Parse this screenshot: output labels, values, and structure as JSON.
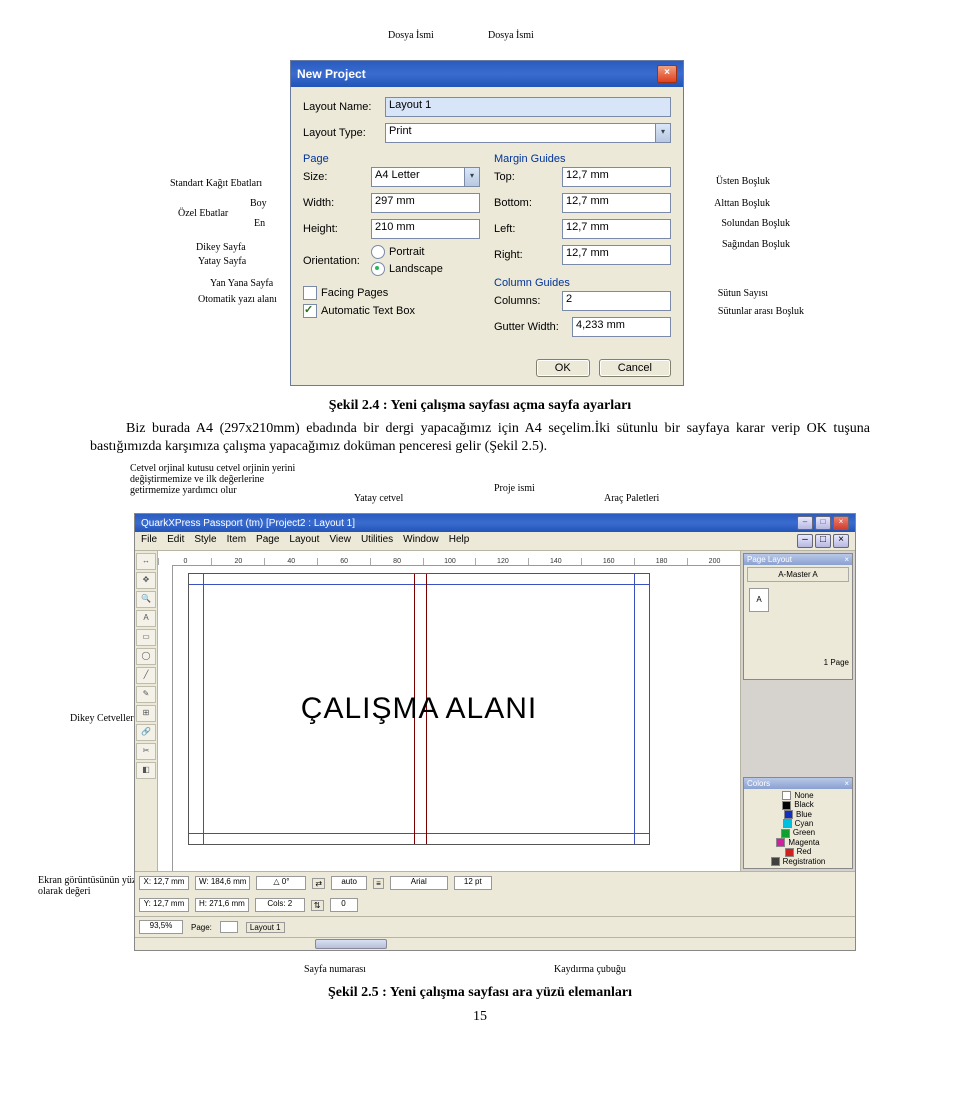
{
  "dialog": {
    "title": "New Project",
    "layout_name_label": "Layout Name:",
    "layout_name_value": "Layout 1",
    "layout_type_label": "Layout Type:",
    "layout_type_value": "Print",
    "page_head": "Page",
    "size_label": "Size:",
    "size_value": "A4 Letter",
    "width_label": "Width:",
    "width_value": "297 mm",
    "height_label": "Height:",
    "height_value": "210 mm",
    "orientation_label": "Orientation:",
    "portrait": "Portrait",
    "landscape": "Landscape",
    "facing": "Facing Pages",
    "autobox": "Automatic Text Box",
    "margin_head": "Margin Guides",
    "top_label": "Top:",
    "bottom_label": "Bottom:",
    "left_label": "Left:",
    "right_label": "Right:",
    "margin_val": "12,7 mm",
    "column_head": "Column Guides",
    "columns_label": "Columns:",
    "columns_value": "2",
    "gutter_label": "Gutter Width:",
    "gutter_value": "4,233 mm",
    "ok": "OK",
    "cancel": "Cancel"
  },
  "ann1": {
    "dosya1": "Dosya İsmi",
    "dosya2": "Dosya İsmi",
    "kagit": "Standart Kağıt Ebatları",
    "boy": "Boy",
    "en": "En",
    "ozel": "Özel Ebatlar",
    "dikey": "Dikey Sayfa",
    "yatay": "Yatay Sayfa",
    "yanyana": "Yan Yana Sayfa",
    "oto": "Otomatik yazı alanı",
    "usten": "Üsten Boşluk",
    "alttan": "Alttan Boşluk",
    "solundan": "Solundan Boşluk",
    "sagindan": "Sağından Boşluk",
    "sutunsay": "Sütun Sayısı",
    "sutunbos": "Sütunlar arası Boşluk"
  },
  "caption1_bold": "Şekil 2.4 : Yeni çalışma sayfası açma sayfa ayarları",
  "para1": "Biz burada A4 (297x210mm) ebadında bir dergi yapacağımız için A4 seçelim.İki sütunlu bir sayfaya karar verip OK tuşuna bastığımızda karşımıza çalışma yapacağımız doküman penceresi gelir (Şekil 2.5).",
  "app": {
    "title": "QuarkXPress Passport (tm)   [Project2 : Layout 1]",
    "menus": [
      "File",
      "Edit",
      "Style",
      "Item",
      "Page",
      "Layout",
      "View",
      "Utilities",
      "Window",
      "Help"
    ],
    "ruler_vals": [
      "0",
      "20",
      "40",
      "60",
      "80",
      "100",
      "120",
      "140",
      "160",
      "180",
      "200"
    ],
    "bigtext": "ÇALIŞMA ALANI",
    "pagelayout_head": "Page Layout",
    "master_a": "A-Master A",
    "page_indicator": "1 Page",
    "colors_head": "Colors",
    "color_list": [
      {
        "name": "None",
        "hex": "#ffffff"
      },
      {
        "name": "Black",
        "hex": "#000000"
      },
      {
        "name": "Blue",
        "hex": "#1030c0"
      },
      {
        "name": "Cyan",
        "hex": "#00c0e0"
      },
      {
        "name": "Green",
        "hex": "#10a030"
      },
      {
        "name": "Magenta",
        "hex": "#d020a0"
      },
      {
        "name": "Red",
        "hex": "#d02020"
      },
      {
        "name": "Registration",
        "hex": "#404040"
      }
    ],
    "measure": {
      "x": "X: 12,7 mm",
      "w": "W: 184,6 mm",
      "ang": "△ 0°",
      "auto": "auto",
      "y": "Y: 12,7 mm",
      "h": "H: 271,6 mm",
      "cols": "Cols: 2",
      "zero": "0",
      "font": "Arial",
      "size": "12 pt"
    },
    "status": {
      "pct": "93,5%",
      "page": "Page:",
      "layout": "Layout 1"
    }
  },
  "ann2": {
    "cetvelbox": "Cetvel orjinal kutusu cetvel orjinin yerini değiştirmemize ve ilk değerlerine getirmemize yardımcı olur",
    "yataycet": "Yatay cetvel",
    "proje": "Proje ismi",
    "paletler": "Araç Paletleri",
    "dikeycet": "Dikey Cetveller",
    "ekrangor": "Ekran görüntüsünün yüzde olarak değeri",
    "sayfanum": "Sayfa numarası",
    "kaydir": "Kaydırma çubuğu"
  },
  "caption2_bold": "Şekil 2.5 : Yeni çalışma sayfası ara yüzü elemanları",
  "pagenum": "15"
}
